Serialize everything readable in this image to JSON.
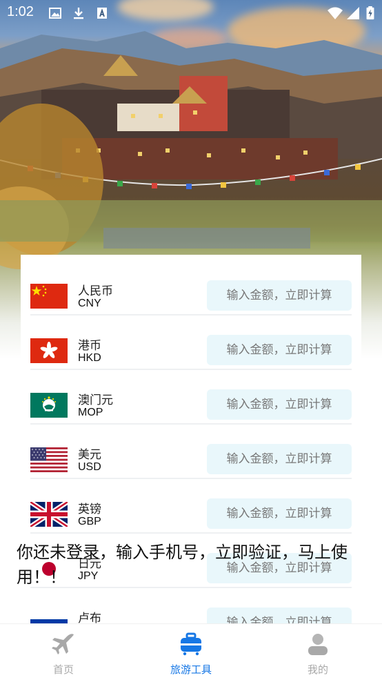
{
  "status_bar": {
    "time": "1:02"
  },
  "currencies": [
    {
      "name": "人民币",
      "code": "CNY"
    },
    {
      "name": "港币",
      "code": "HKD"
    },
    {
      "name": "澳门元",
      "code": "MOP"
    },
    {
      "name": "美元",
      "code": "USD"
    },
    {
      "name": "英镑",
      "code": "GBP"
    },
    {
      "name": "日元",
      "code": "JPY"
    },
    {
      "name": "卢布",
      "code": ""
    }
  ],
  "amount_placeholder": "输入金额，立即计算",
  "toast": "你还未登录，输入手机号，立即验证，马上使用！！",
  "bottom_nav": {
    "items": [
      {
        "label": "首页",
        "icon": "plane-icon",
        "active": false
      },
      {
        "label": "旅游工具",
        "icon": "suitcase-icon",
        "active": true
      },
      {
        "label": "我的",
        "icon": "user-icon",
        "active": false
      }
    ],
    "active_color": "#1677e5",
    "inactive_color": "#a8a8a8"
  }
}
